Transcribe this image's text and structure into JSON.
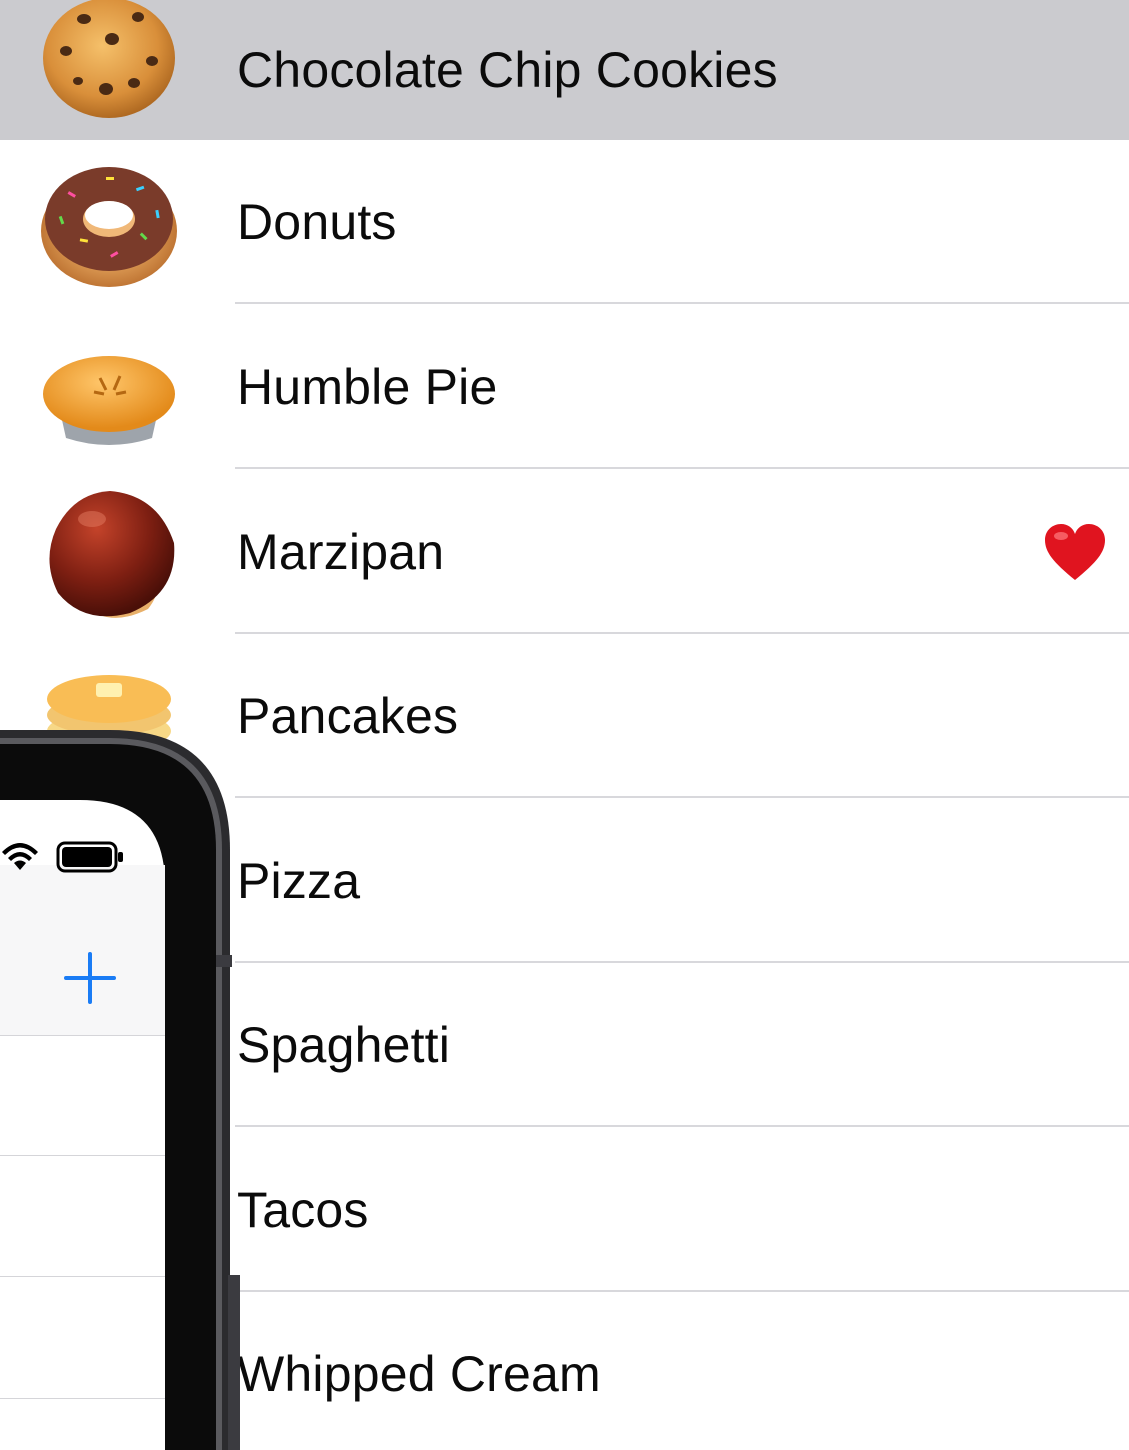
{
  "list": {
    "items": [
      {
        "label": "Chocolate Chip Cookies",
        "icon": "cookie-icon",
        "selected": true,
        "favorite": false
      },
      {
        "label": "Donuts",
        "icon": "donut-icon",
        "selected": false,
        "favorite": false
      },
      {
        "label": "Humble Pie",
        "icon": "pie-icon",
        "selected": false,
        "favorite": false
      },
      {
        "label": "Marzipan",
        "icon": "chestnut-icon",
        "selected": false,
        "favorite": true
      },
      {
        "label": "Pancakes",
        "icon": "pancakes-icon",
        "selected": false,
        "favorite": false
      },
      {
        "label": "Pizza",
        "icon": "",
        "selected": false,
        "favorite": false
      },
      {
        "label": "Spaghetti",
        "icon": "",
        "selected": false,
        "favorite": false
      },
      {
        "label": "Tacos",
        "icon": "",
        "selected": false,
        "favorite": false
      },
      {
        "label": "Whipped Cream",
        "icon": "",
        "selected": false,
        "favorite": false
      }
    ],
    "favorite_icon": "heart-icon"
  },
  "phone": {
    "status_icons": [
      "wifi-icon",
      "battery-icon"
    ],
    "add_icon": "plus-icon",
    "accent": "#1a7cf5"
  },
  "colors": {
    "selected_row": "#cbcbcf",
    "separator": "#d8d8dc",
    "heart": "#e0141f"
  }
}
